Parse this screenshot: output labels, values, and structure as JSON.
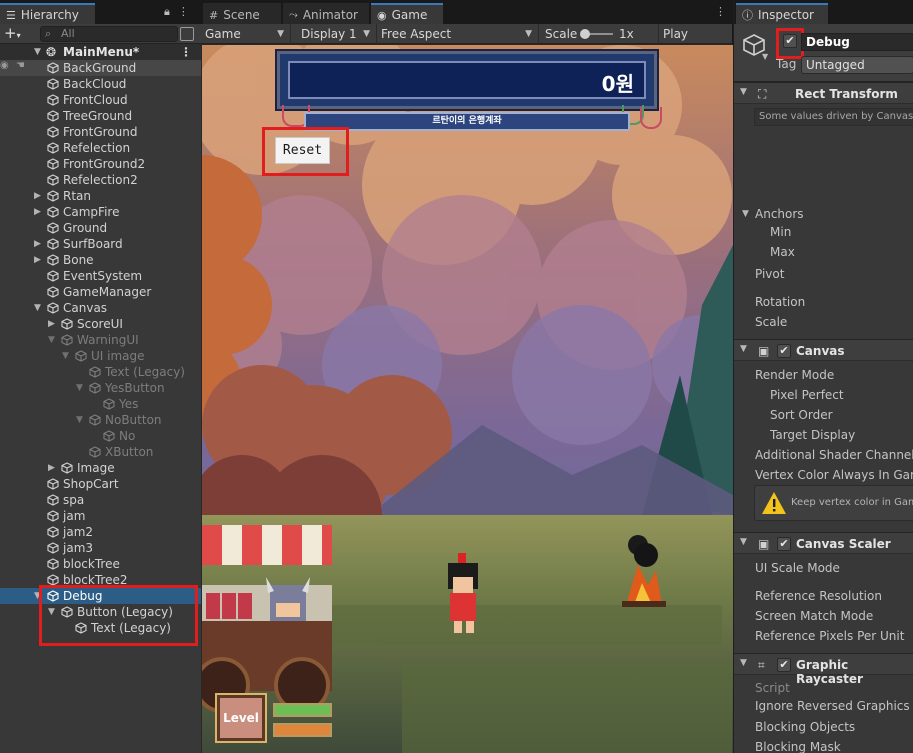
{
  "hierarchy": {
    "tab_label": "Hierarchy",
    "search_placeholder": "All",
    "scene_name": "MainMenu*",
    "items": [
      {
        "label": "BackGround",
        "depth": 1,
        "arrow": "",
        "dim": false
      },
      {
        "label": "BackCloud",
        "depth": 1,
        "arrow": "",
        "dim": false
      },
      {
        "label": "FrontCloud",
        "depth": 1,
        "arrow": "",
        "dim": false
      },
      {
        "label": "TreeGround",
        "depth": 1,
        "arrow": "",
        "dim": false
      },
      {
        "label": "FrontGround",
        "depth": 1,
        "arrow": "",
        "dim": false
      },
      {
        "label": "Refelection",
        "depth": 1,
        "arrow": "",
        "dim": false
      },
      {
        "label": "FrontGround2",
        "depth": 1,
        "arrow": "",
        "dim": false
      },
      {
        "label": "Refelection2",
        "depth": 1,
        "arrow": "",
        "dim": false
      },
      {
        "label": "Rtan",
        "depth": 1,
        "arrow": "collapsed",
        "dim": false
      },
      {
        "label": "CampFire",
        "depth": 1,
        "arrow": "collapsed",
        "dim": false
      },
      {
        "label": "Ground",
        "depth": 1,
        "arrow": "",
        "dim": false
      },
      {
        "label": "SurfBoard",
        "depth": 1,
        "arrow": "collapsed",
        "dim": false
      },
      {
        "label": "Bone",
        "depth": 1,
        "arrow": "collapsed",
        "dim": false
      },
      {
        "label": "EventSystem",
        "depth": 1,
        "arrow": "",
        "dim": false
      },
      {
        "label": "GameManager",
        "depth": 1,
        "arrow": "",
        "dim": false
      },
      {
        "label": "Canvas",
        "depth": 1,
        "arrow": "expanded",
        "dim": false
      },
      {
        "label": "ScoreUI",
        "depth": 2,
        "arrow": "collapsed",
        "dim": false
      },
      {
        "label": "WarningUI",
        "depth": 2,
        "arrow": "expanded",
        "dim": true
      },
      {
        "label": "UI image",
        "depth": 3,
        "arrow": "expanded",
        "dim": true
      },
      {
        "label": "Text (Legacy)",
        "depth": 4,
        "arrow": "",
        "dim": true
      },
      {
        "label": "YesButton",
        "depth": 4,
        "arrow": "expanded",
        "dim": true
      },
      {
        "label": "Yes",
        "depth": 5,
        "arrow": "",
        "dim": true
      },
      {
        "label": "NoButton",
        "depth": 4,
        "arrow": "expanded",
        "dim": true
      },
      {
        "label": "No",
        "depth": 5,
        "arrow": "",
        "dim": true
      },
      {
        "label": "XButton",
        "depth": 4,
        "arrow": "",
        "dim": true
      },
      {
        "label": "Image",
        "depth": 2,
        "arrow": "collapsed",
        "dim": false
      },
      {
        "label": "ShopCart",
        "depth": 1,
        "arrow": "",
        "dim": false
      },
      {
        "label": "spa",
        "depth": 1,
        "arrow": "",
        "dim": false
      },
      {
        "label": "jam",
        "depth": 1,
        "arrow": "",
        "dim": false
      },
      {
        "label": "jam2",
        "depth": 1,
        "arrow": "",
        "dim": false
      },
      {
        "label": "jam3",
        "depth": 1,
        "arrow": "",
        "dim": false
      },
      {
        "label": "blockTree",
        "depth": 1,
        "arrow": "",
        "dim": false
      },
      {
        "label": "blockTree2",
        "depth": 1,
        "arrow": "",
        "dim": false
      },
      {
        "label": "Debug",
        "depth": 1,
        "arrow": "expanded",
        "dim": false,
        "selected": true
      },
      {
        "label": "Button (Legacy)",
        "depth": 2,
        "arrow": "expanded",
        "dim": false
      },
      {
        "label": "Text (Legacy)",
        "depth": 3,
        "arrow": "",
        "dim": false
      }
    ]
  },
  "tabs": {
    "scene": "Scene",
    "animator": "Animator",
    "game": "Game",
    "inspector": "Inspector"
  },
  "game_toolbar": {
    "mode": "Game",
    "display": "Display 1",
    "aspect": "Free Aspect",
    "scale_label": "Scale",
    "scale_value": "1x",
    "play_focused": "Play Focused"
  },
  "game": {
    "score": "0원",
    "bank_label": "르탄이의 은행계좌",
    "reset_label": "Reset",
    "level_label": "Level"
  },
  "inspector": {
    "object_name": "Debug",
    "tag_label": "Tag",
    "tag_value": "Untagged",
    "rect_transform": {
      "title": "Rect Transform",
      "note": "Some values driven by Canvas.",
      "anchors": "Anchors",
      "min": "Min",
      "max": "Max",
      "pivot": "Pivot",
      "rotation": "Rotation",
      "scale": "Scale"
    },
    "canvas": {
      "title": "Canvas",
      "render_mode": "Render Mode",
      "pixel_perfect": "Pixel Perfect",
      "sort_order": "Sort Order",
      "target_display": "Target Display",
      "additional_channels": "Additional Shader Channels",
      "vertex_color": "Vertex Color Always In Gamma",
      "warning": "Keep vertex color in Gamma"
    },
    "canvas_scaler": {
      "title": "Canvas Scaler",
      "ui_scale_mode": "UI Scale Mode",
      "reference_resolution": "Reference Resolution",
      "screen_match_mode": "Screen Match Mode",
      "reference_ppu": "Reference Pixels Per Unit"
    },
    "graphic_raycaster": {
      "title": "Graphic Raycaster",
      "script": "Script",
      "ignore_reversed": "Ignore Reversed Graphics",
      "blocking_objects": "Blocking Objects",
      "blocking_mask": "Blocking Mask"
    }
  },
  "colors": {
    "selection": "#2c5d87",
    "highlight_box": "#e01e1e",
    "tab_accent": "#3a79bb"
  }
}
